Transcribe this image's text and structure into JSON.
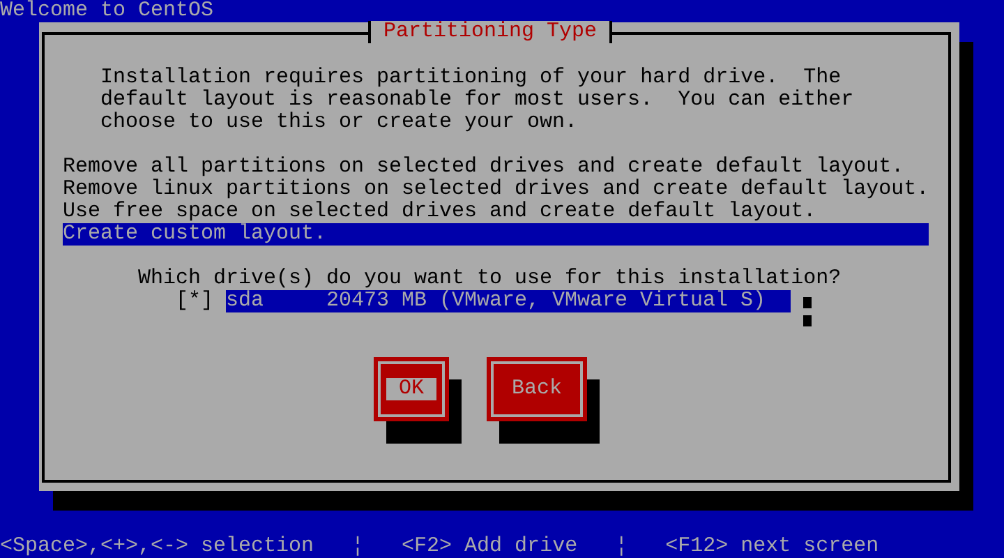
{
  "window": {
    "title": "Welcome to CentOS"
  },
  "dialog": {
    "title": "Partitioning Type",
    "message": [
      "Installation requires partitioning of your hard drive.  The",
      "default layout is reasonable for most users.  You can either",
      "choose to use this or create your own."
    ],
    "options": [
      {
        "label": "Remove all partitions on selected drives and create default layout.",
        "selected": false
      },
      {
        "label": "Remove linux partitions on selected drives and create default layout.",
        "selected": false
      },
      {
        "label": "Use free space on selected drives and create default layout.",
        "selected": false
      },
      {
        "label": "Create custom layout.",
        "selected": true
      }
    ],
    "drive_prompt": "Which drive(s) do you want to use for this installation?",
    "drives": [
      {
        "mark": "[*]",
        "checked": true,
        "label": "sda     20473 MB (VMware, VMware Virtual S)",
        "selected": true
      }
    ],
    "buttons": [
      {
        "label": "OK",
        "focused": true
      },
      {
        "label": "Back",
        "focused": false
      }
    ]
  },
  "status_bar": "<Space>,<+>,<-> selection   ¦   <F2> Add drive   ¦   <F12> next screen"
}
